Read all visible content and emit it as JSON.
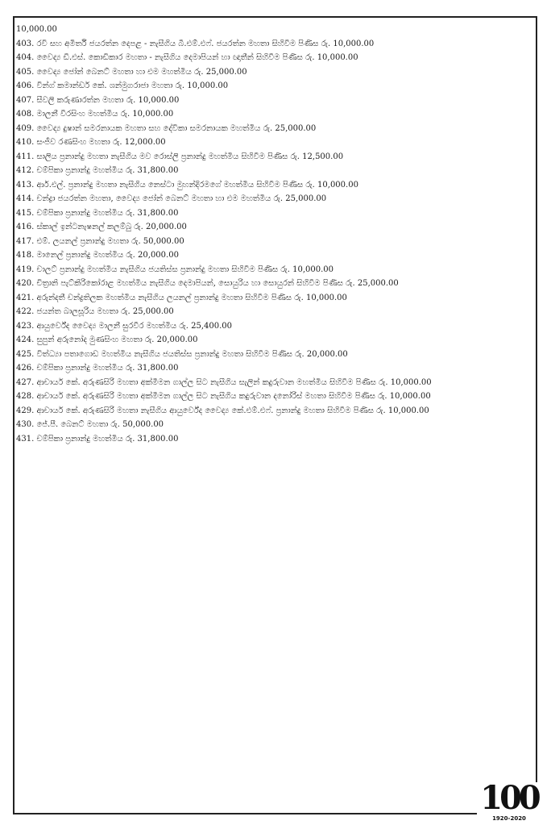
{
  "document": {
    "lines": [
      "10,000.00",
      "403. රවි සහ අමිර්ති ජයරත්න දෙපළ - නැසීගිය බී.එම්.එෆ්. ජයරත්න මහතා සිහිවීම පිණිස රු. 10,000.00",
      "404. වෛද්‍ය ඩී.එස්. කොඩිකාර මහතා - නැසීගිය දෙමාපියන් හා ඥාතීන් සිහිවීම පිණිස රු. 10,000.00",
      "405. වෛද්‍ය ජෝන් බෙනට් මහතා හා එම මහත්මිය රු. 25,000.00",
      "406. වින්ග් කමාන්ඩර් කේ. ශන්මුගරාජා මහතා රු. 10,000.00",
      "407. සීවලි කරුණාරත්න මහතා රු. 10,000.00",
      "408. මාලනී වීරසිංහ මහත්මිය රු. 10,000.00",
      "409. වෛද්‍ය දුෂාන් සමරනායක මහතා සහ දේවිකා සමරනායක මහත්මිය රු. 25,000.00",
      "410. සංජීව රණසිංහ මහතා රු. 12,000.00",
      "411. සාලිය ප්‍රනාන්දු මහතා නැසීගිය මව රොස්ලි ප්‍රනාන්දු මහත්මිය සිහිවීම පිණිස රු. 12,500.00",
      "412. චම්පිකා ප්‍රනාන්දු මහත්මිය රු. 31,800.00",
      "413. ආර්.එල්. ප්‍රනාන්දු මහතා නැසීගිය නෙස්ටා මුහන්දිරමගේ මහත්මිය සිහිවීම පිණිස රු. 10,000.00",
      "414. චන්ද්‍රා ජයරත්න මහතා, වෛද්‍ය ජෝන් බෙනට් මහතා හා එම මහත්මිය රු. 25,000.00",
      "415. චම්පිකා ප්‍රනාන්දු මහත්මිය රු. 31,800.00",
      "416. ස්කාල් ඉන්ටනැෂනල් කලම්බු රු. 20,000.00",
      "417. එම්. ලයනල් ප්‍රනාන්දු මහතා රු. 50,000.00",
      "418. මානෙල් ප්‍රනාන්දු මහත්මිය රු. 20,000.00",
      "419. චාලට් ප්‍රනාන්දු මහත්මිය නැසීගිය ජයතිස්ස ප්‍රනාන්දු මහතා සිහිවීම පිණිස රු. 10,000.00",
      "420. චිත්‍රානි පැට්කිරිකෝරාළ මහත්මිය නැසීගිය දෙමාපියන්, සොයුරිය හා සොයුරන් සිහිවීම පිණිස රු. 25,000.00",
      "421. අරුන්දතී චන්ද්‍රතිලක මහත්මිය නැසීගිය ලයනල් ප්‍රනාන්දු මහතා සිහිවීම පිණිස රු. 10,000.00",
      "422. ජයන්ත බාලසූරිය මහතා රු. 25,000.00",
      "423. ආයුර්වේද වෛද්‍ය මාලනී සුරවීර මහත්මිය රු. 25,400.00",
      "424. සුපුන් අරුනෝද මුණසිංහ මහතා රු. 20,000.00",
      "425. විත්ධ්‍යා පතාගොඩ මහත්මිය නැසීගිය ජයතිස්ස ප්‍රනාන්දු මහතා සිහිවීම පිණිස රු. 20,000.00",
      "426. චම්පිකා ප්‍රනාන්දු මහත්මිය රු. 31,800.00",
      "427. ආචාර්ය කේ. අරුණසිරි මහතා අක්මීමන ගාල්ල සිට නැසීගිය සැලින් කදුරුවාන මහත්මිය සිහිවීම පිණිස රු. 10,000.00",
      "428. ආචාර්ය කේ. අරුණසිරි මහතා අක්මීමන ගාල්ල සිට නැසීගිය කදුරුවාන දනෝරිස් මහතා සිහිවීම පිණිස රු. 10,000.00",
      "429. ආචාර්ය කේ. අරුණසිරි මහතා නැසීගිය ආයුර්වේද වෛද්‍ය කේ.එම්.එෆ්. ප්‍රනාන්දු මහතා සිහිවීම පිණිස රු. 10,000.00",
      "430. ජේ.පී. බෙනට් මහතා රු. 50,000.00",
      "431. චම්පිකා ප්‍රනාන්දු මහත්මිය රු. 31,800.00"
    ]
  },
  "logo": {
    "number": "100",
    "years": "1920-2020"
  }
}
